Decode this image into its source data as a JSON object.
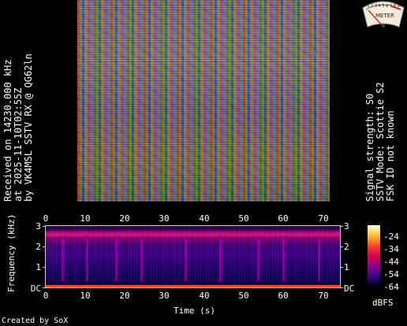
{
  "caption_left": {
    "line1": "Received on  14230.000 kHz",
    "line2": "at 2025-11-10T02:55Z",
    "line3": "by VK4MSL SSTV RX @ QG62ln"
  },
  "caption_right": {
    "line1": "Signal strength: S0",
    "line2": "SSTV Mode: Scottie S2",
    "line3": "FSK ID not known"
  },
  "meter": {
    "scale_text": "1 2 3 4 5 6 7 8 9",
    "label": "METER",
    "needle_level": 0
  },
  "spectrogram": {
    "x_ticks": [
      "0",
      "10",
      "20",
      "30",
      "40",
      "50",
      "60",
      "70"
    ],
    "y_ticks_left": [
      "3",
      "2",
      "1",
      "DC"
    ],
    "y_ticks_right": [
      "3",
      "2",
      "1",
      "DC"
    ],
    "x_title": "Time (s)",
    "y_title": "Frequency (kHz)"
  },
  "colorbar": {
    "labels": [
      "-24",
      "-34",
      "-44",
      "-54",
      "-64"
    ],
    "unit": "dBFS"
  },
  "footer": {
    "credit": "Created by SoX"
  }
}
